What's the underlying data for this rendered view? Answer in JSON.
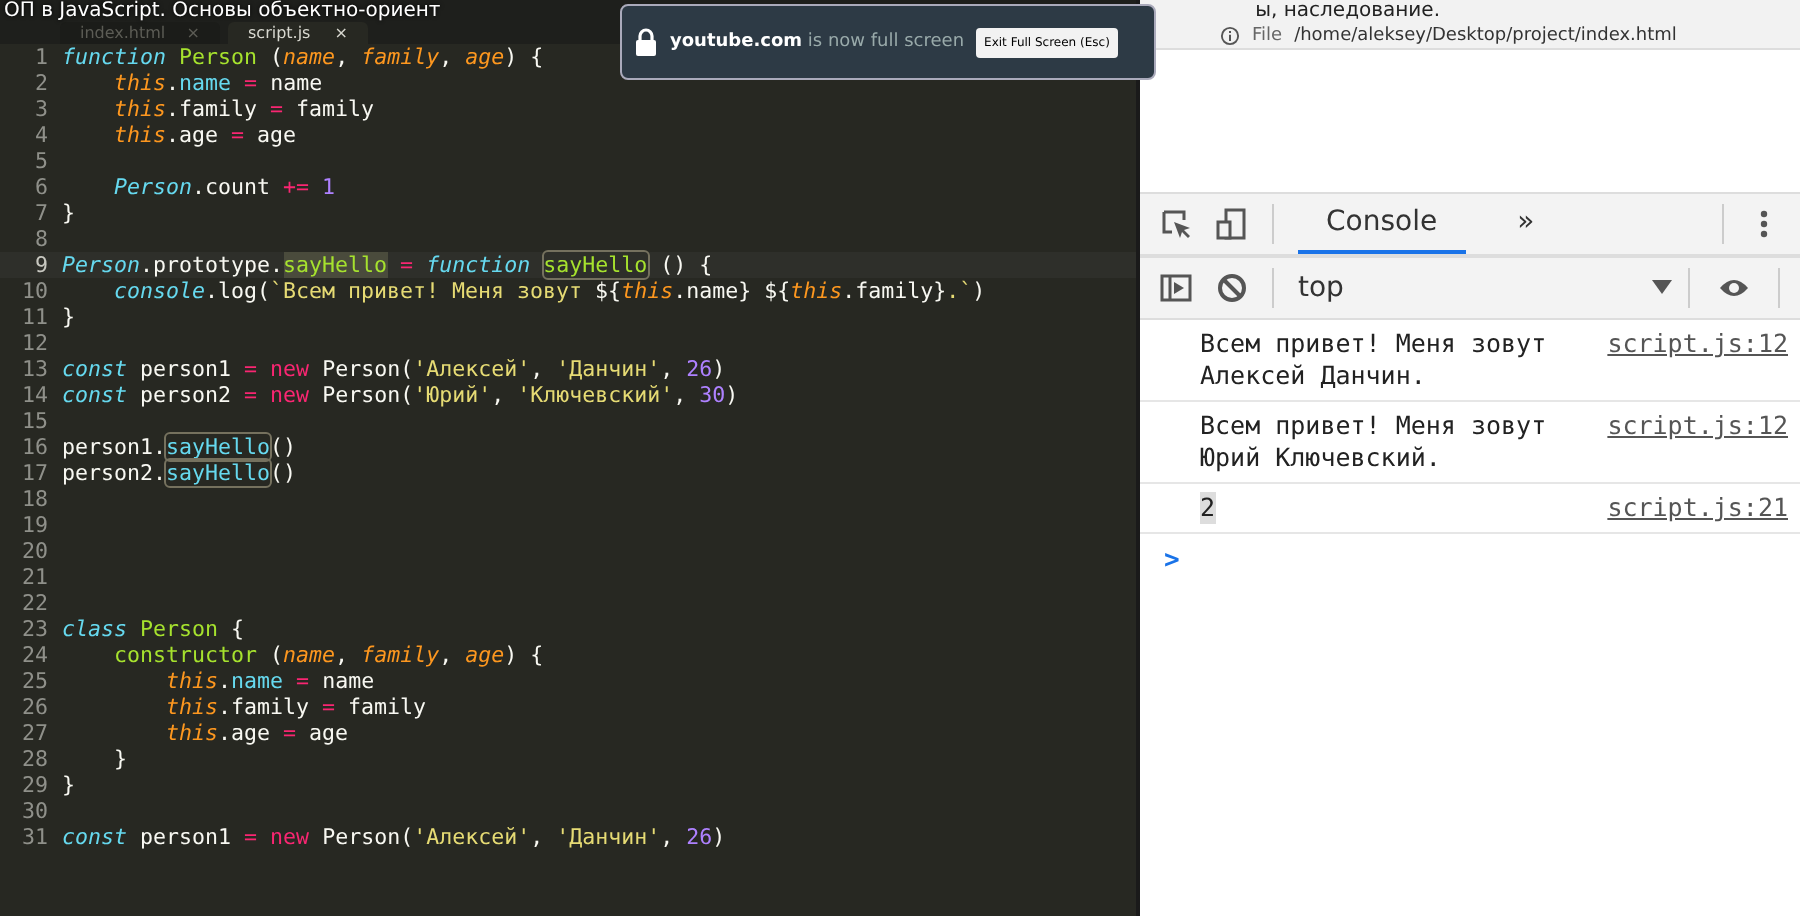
{
  "video_title": {
    "left": "ОП в JavaScript. Основы объектно-ориент",
    "right": "ы, наследование."
  },
  "fullscreen_notice": {
    "site": "youtube.com",
    "message": "is now full screen",
    "button": "Exit Full Screen (Esc)"
  },
  "editor": {
    "tabs": [
      {
        "label": "index.html",
        "close": "×",
        "selected": false
      },
      {
        "label": "script.js",
        "close": "×",
        "selected": true
      }
    ],
    "lines": [
      {
        "n": "1",
        "current": false,
        "tokens": [
          {
            "kind": "kw",
            "text": "function"
          },
          {
            "kind": "name",
            "text": " Person"
          },
          {
            "kind": "plain",
            "text": " ("
          },
          {
            "kind": "param",
            "text": "name"
          },
          {
            "kind": "plain",
            "text": ", "
          },
          {
            "kind": "param",
            "text": "family"
          },
          {
            "kind": "plain",
            "text": ", "
          },
          {
            "kind": "param",
            "text": "age"
          },
          {
            "kind": "plain",
            "text": ") {"
          }
        ]
      },
      {
        "n": "2",
        "current": false,
        "tokens": [
          {
            "kind": "this",
            "text": "    this"
          },
          {
            "kind": "plain",
            "text": "."
          },
          {
            "kind": "prop",
            "text": "name"
          },
          {
            "kind": "op",
            "text": " ="
          },
          {
            "kind": "plain",
            "text": " name"
          }
        ]
      },
      {
        "n": "3",
        "current": false,
        "tokens": [
          {
            "kind": "this",
            "text": "    this"
          },
          {
            "kind": "plain",
            "text": ".family"
          },
          {
            "kind": "op",
            "text": " ="
          },
          {
            "kind": "plain",
            "text": " family"
          }
        ]
      },
      {
        "n": "4",
        "current": false,
        "tokens": [
          {
            "kind": "this",
            "text": "    this"
          },
          {
            "kind": "plain",
            "text": ".age"
          },
          {
            "kind": "op",
            "text": " ="
          },
          {
            "kind": "plain",
            "text": " age"
          }
        ]
      },
      {
        "n": "5",
        "current": false
      },
      {
        "n": "6",
        "current": false,
        "tokens": [
          {
            "kind": "cls",
            "text": "    Person"
          },
          {
            "kind": "plain",
            "text": ".count"
          },
          {
            "kind": "op",
            "text": " +="
          },
          {
            "kind": "num",
            "text": " 1"
          }
        ]
      },
      {
        "n": "7",
        "current": false,
        "tokens": [
          {
            "kind": "plain",
            "text": "}"
          }
        ]
      },
      {
        "n": "8",
        "current": false
      },
      {
        "n": "9",
        "current": true,
        "tokens": [
          {
            "kind": "cls",
            "text": "Person"
          },
          {
            "kind": "plain",
            "text": ".prototype."
          },
          {
            "kind": "match",
            "text": "sayHello"
          },
          {
            "kind": "op",
            "text": " ="
          },
          {
            "kind": "kw",
            "text": " function "
          },
          {
            "kind": "boxed",
            "text": "sayHello"
          },
          {
            "kind": "plain",
            "text": " () {"
          }
        ]
      },
      {
        "n": "10",
        "current": false,
        "tokens": [
          {
            "kind": "cls",
            "text": "    console"
          },
          {
            "kind": "plain",
            "text": ".log("
          },
          {
            "kind": "str",
            "text": "`Всем привет! Меня зовут "
          },
          {
            "kind": "plain",
            "text": "${"
          },
          {
            "kind": "this",
            "text": "this"
          },
          {
            "kind": "plain",
            "text": ".name} ${"
          },
          {
            "kind": "this",
            "text": "this"
          },
          {
            "kind": "plain",
            "text": ".family}"
          },
          {
            "kind": "str",
            "text": ".`"
          },
          {
            "kind": "plain",
            "text": ")"
          }
        ]
      },
      {
        "n": "11",
        "current": false,
        "tokens": [
          {
            "kind": "plain",
            "text": "}"
          }
        ]
      },
      {
        "n": "12",
        "current": false
      },
      {
        "n": "13",
        "current": false,
        "tokens": [
          {
            "kind": "kw",
            "text": "const"
          },
          {
            "kind": "plain",
            "text": " person1"
          },
          {
            "kind": "op",
            "text": " ="
          },
          {
            "kind": "op",
            "text": " new"
          },
          {
            "kind": "plain",
            "text": " Person("
          },
          {
            "kind": "str",
            "text": "'Алексей'"
          },
          {
            "kind": "plain",
            "text": ", "
          },
          {
            "kind": "str",
            "text": "'Данчин'"
          },
          {
            "kind": "plain",
            "text": ", "
          },
          {
            "kind": "num",
            "text": "26"
          },
          {
            "kind": "plain",
            "text": ")"
          }
        ]
      },
      {
        "n": "14",
        "current": false,
        "tokens": [
          {
            "kind": "kw",
            "text": "const"
          },
          {
            "kind": "plain",
            "text": " person2"
          },
          {
            "kind": "op",
            "text": " ="
          },
          {
            "kind": "op",
            "text": " new"
          },
          {
            "kind": "plain",
            "text": " Person("
          },
          {
            "kind": "str",
            "text": "'Юрий'"
          },
          {
            "kind": "plain",
            "text": ", "
          },
          {
            "kind": "str",
            "text": "'Ключевский'"
          },
          {
            "kind": "plain",
            "text": ", "
          },
          {
            "kind": "num",
            "text": "30"
          },
          {
            "kind": "plain",
            "text": ")"
          }
        ]
      },
      {
        "n": "15",
        "current": false
      },
      {
        "n": "16",
        "current": false,
        "tokens": [
          {
            "kind": "plain",
            "text": "person1."
          },
          {
            "kind": "selbox",
            "text": "sayHello"
          },
          {
            "kind": "plain",
            "text": "()"
          }
        ]
      },
      {
        "n": "17",
        "current": false,
        "tokens": [
          {
            "kind": "plain",
            "text": "person2."
          },
          {
            "kind": "selbox",
            "text": "sayHello"
          },
          {
            "kind": "plain",
            "text": "()"
          }
        ]
      },
      {
        "n": "18",
        "current": false
      },
      {
        "n": "19",
        "current": false
      },
      {
        "n": "20",
        "current": false
      },
      {
        "n": "21",
        "current": false
      },
      {
        "n": "22",
        "current": false
      },
      {
        "n": "23",
        "current": false,
        "tokens": [
          {
            "kind": "kw",
            "text": "class"
          },
          {
            "kind": "name",
            "text": " Person"
          },
          {
            "kind": "plain",
            "text": " {"
          }
        ]
      },
      {
        "n": "24",
        "current": false,
        "tokens": [
          {
            "kind": "name",
            "text": "    constructor"
          },
          {
            "kind": "plain",
            "text": " ("
          },
          {
            "kind": "param",
            "text": "name"
          },
          {
            "kind": "plain",
            "text": ", "
          },
          {
            "kind": "param",
            "text": "family"
          },
          {
            "kind": "plain",
            "text": ", "
          },
          {
            "kind": "param",
            "text": "age"
          },
          {
            "kind": "plain",
            "text": ") {"
          }
        ]
      },
      {
        "n": "25",
        "current": false,
        "tokens": [
          {
            "kind": "this",
            "text": "        this"
          },
          {
            "kind": "plain",
            "text": "."
          },
          {
            "kind": "prop",
            "text": "name"
          },
          {
            "kind": "op",
            "text": " ="
          },
          {
            "kind": "plain",
            "text": " name"
          }
        ]
      },
      {
        "n": "26",
        "current": false,
        "tokens": [
          {
            "kind": "this",
            "text": "        this"
          },
          {
            "kind": "plain",
            "text": ".family"
          },
          {
            "kind": "op",
            "text": " ="
          },
          {
            "kind": "plain",
            "text": " family"
          }
        ]
      },
      {
        "n": "27",
        "current": false,
        "tokens": [
          {
            "kind": "this",
            "text": "        this"
          },
          {
            "kind": "plain",
            "text": ".age"
          },
          {
            "kind": "op",
            "text": " ="
          },
          {
            "kind": "plain",
            "text": " age"
          }
        ]
      },
      {
        "n": "28",
        "current": false,
        "tokens": [
          {
            "kind": "plain",
            "text": "    }"
          }
        ]
      },
      {
        "n": "29",
        "current": false,
        "tokens": [
          {
            "kind": "plain",
            "text": "}"
          }
        ]
      },
      {
        "n": "30",
        "current": false
      },
      {
        "n": "31",
        "current": false,
        "tokens": [
          {
            "kind": "kw",
            "text": "const"
          },
          {
            "kind": "plain",
            "text": " person1"
          },
          {
            "kind": "op",
            "text": " ="
          },
          {
            "kind": "op",
            "text": " new"
          },
          {
            "kind": "plain",
            "text": " Person("
          },
          {
            "kind": "str",
            "text": "'Алексей'"
          },
          {
            "kind": "plain",
            "text": ", "
          },
          {
            "kind": "str",
            "text": "'Данчин'"
          },
          {
            "kind": "plain",
            "text": ", "
          },
          {
            "kind": "num",
            "text": "26"
          },
          {
            "kind": "plain",
            "text": ")"
          }
        ]
      }
    ]
  },
  "browser": {
    "scheme": "File",
    "address": "/home/aleksey/Desktop/project/index.html"
  },
  "devtools": {
    "tabs": [
      {
        "label": "Console",
        "selected": true
      },
      {
        "label": "»",
        "selected": false
      }
    ],
    "context": "top",
    "messages": [
      {
        "text": "Всем привет! Меня зовут Алексей Данчин.",
        "source": "script.js:12",
        "highlighted": false
      },
      {
        "text": "Всем привет! Меня зовут Юрий Ключевский.",
        "source": "script.js:12",
        "highlighted": false
      },
      {
        "text": "2",
        "source": "script.js:21",
        "highlighted": true
      }
    ],
    "prompt": ">"
  }
}
